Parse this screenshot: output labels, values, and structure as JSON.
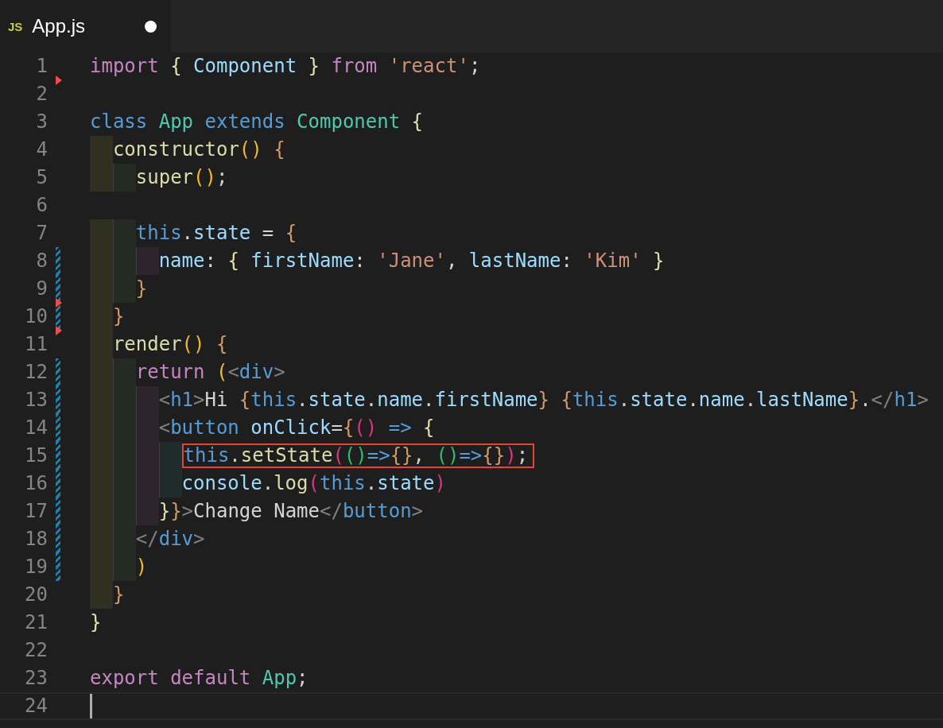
{
  "tab": {
    "icon_label": "JS",
    "title": "App.js",
    "modified": true
  },
  "lines": [
    {
      "number": "1",
      "deleted_below": true,
      "tokens": [
        {
          "t": "import ",
          "kind": "kw"
        },
        {
          "t": "{ ",
          "kind": "b1"
        },
        {
          "t": "Component ",
          "kind": "prop"
        },
        {
          "t": "} ",
          "kind": "b1"
        },
        {
          "t": "from ",
          "kind": "kw"
        },
        {
          "t": "'react'",
          "kind": "str"
        },
        {
          "t": ";",
          "kind": "plain"
        }
      ]
    },
    {
      "number": "2"
    },
    {
      "number": "3",
      "tokens": [
        {
          "t": "class ",
          "kind": "storage"
        },
        {
          "t": "App ",
          "kind": "cls"
        },
        {
          "t": "extends ",
          "kind": "storage"
        },
        {
          "t": "Component ",
          "kind": "cls"
        },
        {
          "t": "{",
          "kind": "b1"
        }
      ]
    },
    {
      "number": "4",
      "guides": [
        {
          "color": "#2f2f22"
        }
      ],
      "tokens": [
        {
          "t": "constructor",
          "kind": "fn"
        },
        {
          "t": "() ",
          "kind": "b2"
        },
        {
          "t": "{",
          "kind": "b3"
        }
      ]
    },
    {
      "number": "5",
      "guides": [
        {
          "color": "#2f2f22"
        },
        {
          "color": "#232b23"
        }
      ],
      "tokens": [
        {
          "t": "super",
          "kind": "fn"
        },
        {
          "t": "()",
          "kind": "b2"
        },
        {
          "t": ";",
          "kind": "plain"
        }
      ]
    },
    {
      "number": "6"
    },
    {
      "number": "7",
      "guides": [
        {
          "color": "#2f2f22"
        },
        {
          "color": "#232b23"
        }
      ],
      "tokens": [
        {
          "t": "this",
          "kind": "storage"
        },
        {
          "t": ".",
          "kind": "plain"
        },
        {
          "t": "state",
          "kind": "prop"
        },
        {
          "t": " = ",
          "kind": "plain"
        },
        {
          "t": "{",
          "kind": "b3"
        }
      ]
    },
    {
      "number": "8",
      "modified": true,
      "guides": [
        {
          "color": "#2f2f22"
        },
        {
          "color": "#232b23"
        },
        {
          "color": "#2d242d"
        }
      ],
      "tokens": [
        {
          "t": "name",
          "kind": "prop"
        },
        {
          "t": ": ",
          "kind": "plain"
        },
        {
          "t": "{ ",
          "kind": "b1"
        },
        {
          "t": "firstName",
          "kind": "prop"
        },
        {
          "t": ": ",
          "kind": "plain"
        },
        {
          "t": "'Jane'",
          "kind": "str"
        },
        {
          "t": ", ",
          "kind": "plain"
        },
        {
          "t": "lastName",
          "kind": "prop"
        },
        {
          "t": ": ",
          "kind": "plain"
        },
        {
          "t": "'Kim' ",
          "kind": "str"
        },
        {
          "t": "}",
          "kind": "b1"
        }
      ]
    },
    {
      "number": "9",
      "modified": true,
      "deleted_below": true,
      "guides": [
        {
          "color": "#2f2f22"
        },
        {
          "color": "#232b23"
        }
      ],
      "tokens": [
        {
          "t": "}",
          "kind": "b3"
        }
      ]
    },
    {
      "number": "10",
      "modified": true,
      "deleted_below": true,
      "guides": [
        {
          "color": "#2f2f22"
        }
      ],
      "tokens": [
        {
          "t": "}",
          "kind": "b3"
        }
      ]
    },
    {
      "number": "11",
      "guides": [
        {
          "color": "#2f2f22"
        }
      ],
      "tokens": [
        {
          "t": "render",
          "kind": "fn"
        },
        {
          "t": "() ",
          "kind": "b2"
        },
        {
          "t": "{",
          "kind": "b3"
        }
      ]
    },
    {
      "number": "12",
      "modified": true,
      "guides": [
        {
          "color": "#2f2f22"
        },
        {
          "color": "#232b23"
        }
      ],
      "tokens": [
        {
          "t": "return ",
          "kind": "kw"
        },
        {
          "t": "(",
          "kind": "b2"
        },
        {
          "t": "<",
          "kind": "punc"
        },
        {
          "t": "div",
          "kind": "storage"
        },
        {
          "t": ">",
          "kind": "punc"
        }
      ]
    },
    {
      "number": "13",
      "modified": true,
      "guides": [
        {
          "color": "#2f2f22"
        },
        {
          "color": "#232b23"
        },
        {
          "color": "#2d242d"
        }
      ],
      "tokens": [
        {
          "t": "<",
          "kind": "punc"
        },
        {
          "t": "h1",
          "kind": "storage"
        },
        {
          "t": ">",
          "kind": "punc"
        },
        {
          "t": "Hi ",
          "kind": "plain"
        },
        {
          "t": "{",
          "kind": "b3"
        },
        {
          "t": "this",
          "kind": "storage"
        },
        {
          "t": ".",
          "kind": "plain"
        },
        {
          "t": "state",
          "kind": "prop"
        },
        {
          "t": ".",
          "kind": "plain"
        },
        {
          "t": "name",
          "kind": "prop"
        },
        {
          "t": ".",
          "kind": "plain"
        },
        {
          "t": "firstName",
          "kind": "prop"
        },
        {
          "t": "} {",
          "kind": "b3"
        },
        {
          "t": "this",
          "kind": "storage"
        },
        {
          "t": ".",
          "kind": "plain"
        },
        {
          "t": "state",
          "kind": "prop"
        },
        {
          "t": ".",
          "kind": "plain"
        },
        {
          "t": "name",
          "kind": "prop"
        },
        {
          "t": ".",
          "kind": "plain"
        },
        {
          "t": "lastName",
          "kind": "prop"
        },
        {
          "t": "}",
          "kind": "b3"
        },
        {
          "t": ".",
          "kind": "plain"
        },
        {
          "t": "</",
          "kind": "punc"
        },
        {
          "t": "h1",
          "kind": "storage"
        },
        {
          "t": ">",
          "kind": "punc"
        }
      ]
    },
    {
      "number": "14",
      "modified": true,
      "guides": [
        {
          "color": "#2f2f22"
        },
        {
          "color": "#232b23"
        },
        {
          "color": "#2d242d"
        }
      ],
      "tokens": [
        {
          "t": "<",
          "kind": "punc"
        },
        {
          "t": "button ",
          "kind": "storage"
        },
        {
          "t": "onClick",
          "kind": "prop"
        },
        {
          "t": "=",
          "kind": "plain"
        },
        {
          "t": "{",
          "kind": "b3"
        },
        {
          "t": "() ",
          "kind": "b4"
        },
        {
          "t": "=> ",
          "kind": "storage"
        },
        {
          "t": "{",
          "kind": "b1"
        }
      ]
    },
    {
      "number": "15",
      "modified": true,
      "boxed": true,
      "guides": [
        {
          "color": "#2f2f22"
        },
        {
          "color": "#232b23"
        },
        {
          "color": "#2d242d"
        },
        {
          "color": "#202b2b"
        }
      ],
      "tokens": [
        {
          "t": "this",
          "kind": "storage"
        },
        {
          "t": ".",
          "kind": "plain"
        },
        {
          "t": "setState",
          "kind": "fn"
        },
        {
          "t": "(",
          "kind": "b4"
        },
        {
          "t": "()",
          "kind": "b5"
        },
        {
          "t": "=>",
          "kind": "storage"
        },
        {
          "t": "{}",
          "kind": "b3"
        },
        {
          "t": ", ",
          "kind": "plain"
        },
        {
          "t": "()",
          "kind": "b5"
        },
        {
          "t": "=>",
          "kind": "storage"
        },
        {
          "t": "{}",
          "kind": "b3"
        },
        {
          "t": ")",
          "kind": "b4"
        },
        {
          "t": ";",
          "kind": "plain"
        }
      ]
    },
    {
      "number": "16",
      "modified": true,
      "guides": [
        {
          "color": "#2f2f22"
        },
        {
          "color": "#232b23"
        },
        {
          "color": "#2d242d"
        },
        {
          "color": "#202b2b"
        }
      ],
      "tokens": [
        {
          "t": "console",
          "kind": "prop"
        },
        {
          "t": ".",
          "kind": "plain"
        },
        {
          "t": "log",
          "kind": "fn"
        },
        {
          "t": "(",
          "kind": "b4"
        },
        {
          "t": "this",
          "kind": "storage"
        },
        {
          "t": ".",
          "kind": "plain"
        },
        {
          "t": "state",
          "kind": "prop"
        },
        {
          "t": ")",
          "kind": "b4"
        }
      ]
    },
    {
      "number": "17",
      "modified": true,
      "guides": [
        {
          "color": "#2f2f22"
        },
        {
          "color": "#232b23"
        },
        {
          "color": "#2d242d"
        }
      ],
      "tokens": [
        {
          "t": "}",
          "kind": "b1"
        },
        {
          "t": "}",
          "kind": "b3"
        },
        {
          "t": ">",
          "kind": "punc"
        },
        {
          "t": "Change Name",
          "kind": "plain"
        },
        {
          "t": "</",
          "kind": "punc"
        },
        {
          "t": "button",
          "kind": "storage"
        },
        {
          "t": ">",
          "kind": "punc"
        }
      ]
    },
    {
      "number": "18",
      "modified": true,
      "guides": [
        {
          "color": "#2f2f22"
        },
        {
          "color": "#232b23"
        }
      ],
      "tokens": [
        {
          "t": "</",
          "kind": "punc"
        },
        {
          "t": "div",
          "kind": "storage"
        },
        {
          "t": ">",
          "kind": "punc"
        }
      ]
    },
    {
      "number": "19",
      "modified": true,
      "guides": [
        {
          "color": "#2f2f22"
        },
        {
          "color": "#232b23"
        }
      ],
      "tokens": [
        {
          "t": ")",
          "kind": "b2"
        }
      ]
    },
    {
      "number": "20",
      "guides": [
        {
          "color": "#2f2f22"
        }
      ],
      "tokens": [
        {
          "t": "}",
          "kind": "b3"
        }
      ]
    },
    {
      "number": "21",
      "tokens": [
        {
          "t": "}",
          "kind": "b1"
        }
      ]
    },
    {
      "number": "22"
    },
    {
      "number": "23",
      "tokens": [
        {
          "t": "export default ",
          "kind": "kw"
        },
        {
          "t": "App",
          "kind": "cls"
        },
        {
          "t": ";",
          "kind": "plain"
        }
      ]
    },
    {
      "number": "24",
      "current": true
    }
  ]
}
